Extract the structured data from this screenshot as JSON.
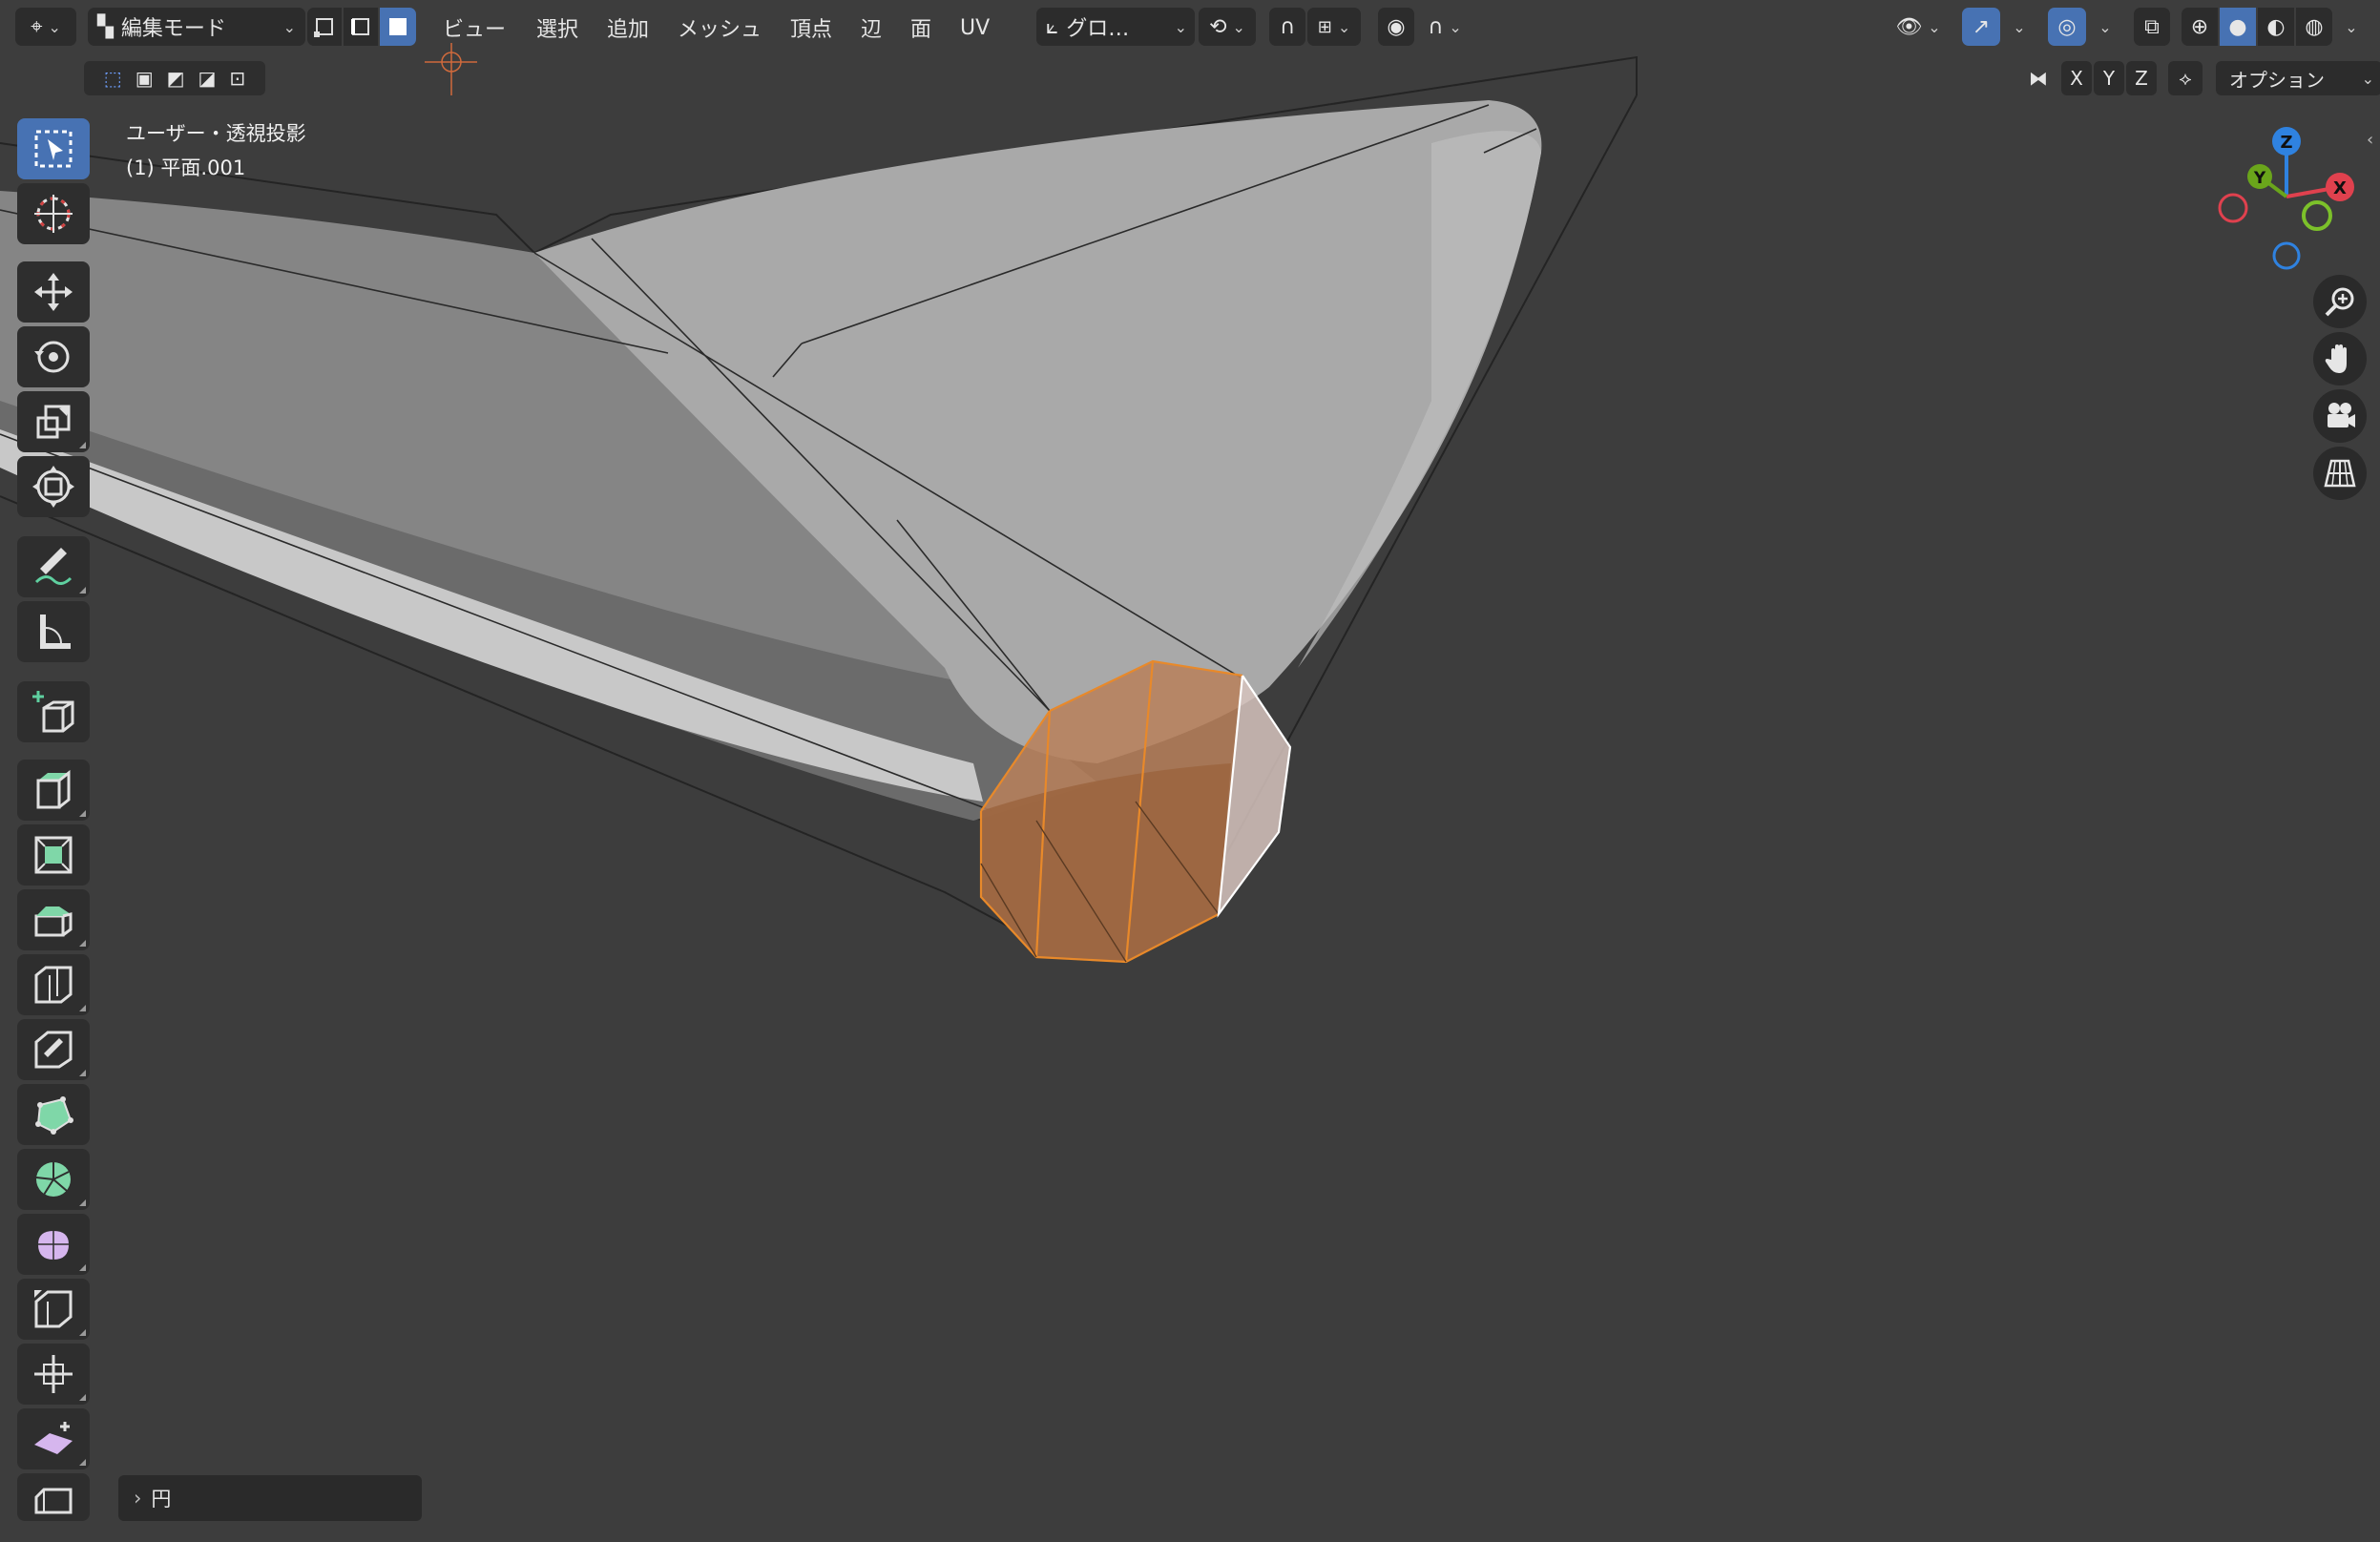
{
  "header": {
    "mode_label": "編集モード",
    "menus": [
      "ビュー",
      "選択",
      "追加",
      "メッシュ",
      "頂点",
      "辺",
      "面",
      "UV"
    ],
    "transform_orientation": "グロ…",
    "options_label": "オプション",
    "axis_x": "X",
    "axis_y": "Y",
    "axis_z": "Z"
  },
  "viewport": {
    "view_name": "ユーザー・透視投影",
    "object_name": "(1) 平面.001"
  },
  "gizmo": {
    "x_label": "X",
    "y_label": "Y",
    "z_label": "Z",
    "colors": {
      "x": "#e0414e",
      "y": "#6aa51b",
      "z": "#2f82e0"
    }
  },
  "operator_panel": {
    "label": "円"
  },
  "colors": {
    "viewport_bg": "#3d3d3d",
    "active_blue": "#4772b3",
    "selection_orange": "#e8892a",
    "mesh_gray": "#9a9a9a"
  },
  "toolbar_icons": [
    "select-box-icon",
    "cursor-icon",
    "move-icon",
    "rotate-icon",
    "scale-icon",
    "transform-icon",
    "annotate-icon",
    "measure-icon",
    "add-cube-icon",
    "extrude-region-icon",
    "inset-faces-icon",
    "bevel-icon",
    "loop-cut-icon",
    "knife-icon",
    "poly-build-icon",
    "spin-icon",
    "smooth-icon",
    "edge-slide-icon",
    "shrink-fatten-icon",
    "shear-icon",
    "rip-region-icon"
  ]
}
